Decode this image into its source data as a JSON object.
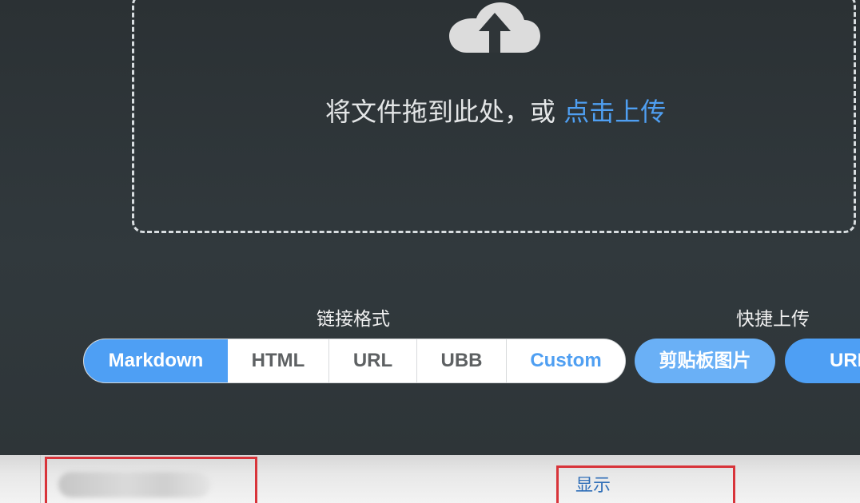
{
  "upload_area": {
    "icon": "cloud-upload-icon",
    "prompt_text": "将文件拖到此处，或",
    "click_upload_link": "点击上传"
  },
  "link_format": {
    "label": "链接格式",
    "options": [
      {
        "label": "Markdown",
        "selected": true
      },
      {
        "label": "HTML",
        "selected": false
      },
      {
        "label": "URL",
        "selected": false
      },
      {
        "label": "UBB",
        "selected": false
      },
      {
        "label": "Custom",
        "selected": false
      }
    ]
  },
  "quick_upload": {
    "label": "快捷上传",
    "clipboard_button": "剪贴板图片",
    "url_button": "URL"
  },
  "bottom_strip": {
    "show_link": "显示"
  },
  "colors": {
    "accent": "#4e9ff4",
    "link": "#4f9ff2",
    "panel_bg": "#2f3538",
    "highlight_box": "#d8343a"
  }
}
